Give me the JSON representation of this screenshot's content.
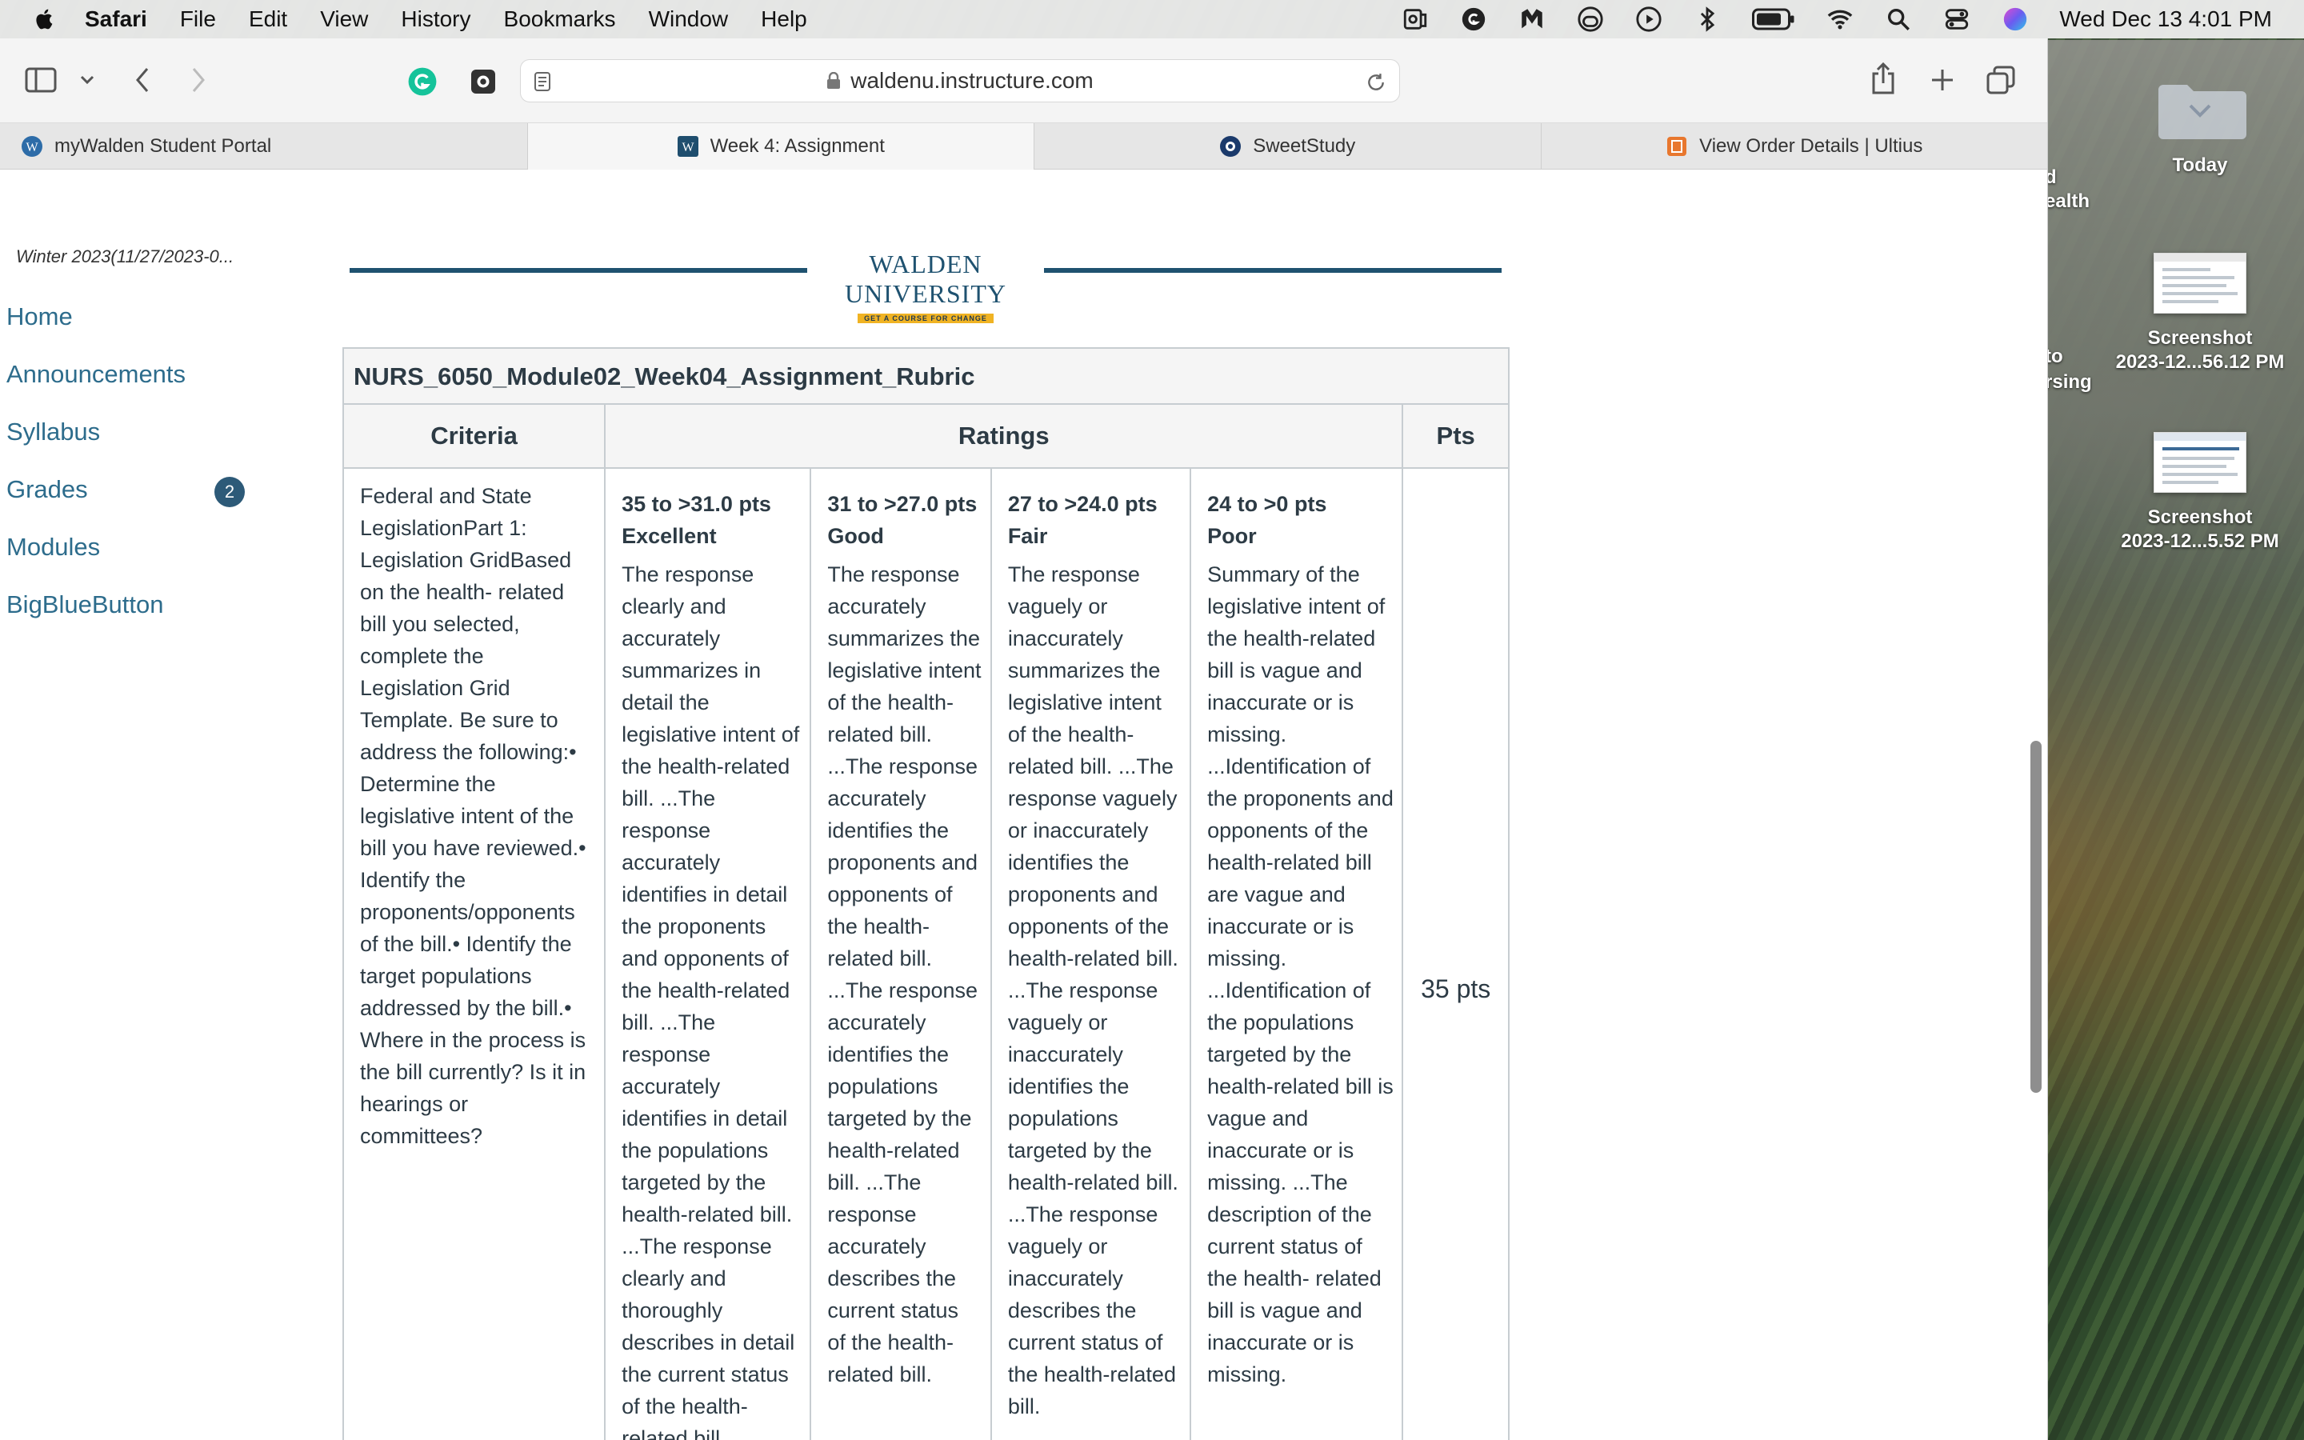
{
  "menubar": {
    "app_name": "Safari",
    "items": [
      "File",
      "Edit",
      "View",
      "History",
      "Bookmarks",
      "Window",
      "Help"
    ],
    "clock": "Wed Dec 13  4:01 PM"
  },
  "toolbar": {
    "url": "waldenu.instructure.com"
  },
  "tabs": [
    {
      "label": "myWalden Student Portal",
      "favicon_color": "#2d6ca8"
    },
    {
      "label": "Week 4: Assignment",
      "favicon_color": "#1f4e6e"
    },
    {
      "label": "SweetStudy",
      "favicon_color": "#1b3a6b"
    },
    {
      "label": "View Order Details | Ultius",
      "favicon_color": "#e8772e"
    }
  ],
  "sidebar": {
    "term": "Winter 2023(11/27/2023-0...",
    "items": [
      {
        "label": "Home"
      },
      {
        "label": "Announcements"
      },
      {
        "label": "Syllabus"
      },
      {
        "label": "Grades",
        "badge": "2"
      },
      {
        "label": "Modules"
      },
      {
        "label": "BigBlueButton"
      }
    ]
  },
  "banner": {
    "name": "WALDEN UNIVERSITY",
    "tagline": "GET A COURSE FOR CHANGE"
  },
  "rubric": {
    "title": "NURS_6050_Module02_Week04_Assignment_Rubric",
    "headers": {
      "criteria": "Criteria",
      "ratings": "Ratings",
      "pts": "Pts"
    },
    "criteria_text": "Federal and State LegislationPart 1: Legislation GridBased on the health- related bill you selected, complete the Legislation Grid Template. Be sure to address the following:• Determine the legislative intent of the bill you have reviewed.• Identify the proponents/opponents of the bill.• Identify the target populations addressed by the bill.• Where in the process is the bill currently? Is it in hearings or committees?",
    "ratings": [
      {
        "pts": "35 to >31.0 pts",
        "label": "Excellent",
        "description": "The response clearly and accurately summarizes in detail the legislative intent of the health-related bill. ...The response accurately identifies in detail the proponents and opponents of the health-related bill. ...The response accurately identifies in detail the populations targeted by the health-related bill. ...The response clearly and thoroughly describes in detail the current status of the health-related bill."
      },
      {
        "pts": "31 to >27.0 pts",
        "label": "Good",
        "description": "The response accurately summarizes the legislative intent of the health-related bill. ...The response accurately identifies the proponents and opponents of the health-related bill. ...The response accurately identifies the populations targeted by the health-related bill. ...The response accurately describes the current status of the health-related bill."
      },
      {
        "pts": "27 to >24.0 pts",
        "label": "Fair",
        "description": "The response vaguely or inaccurately summarizes the legislative intent of the health-related bill. ...The response vaguely or inaccurately identifies the proponents and opponents of the health-related bill. ...The response vaguely or inaccurately identifies the populations targeted by the health-related bill. ...The response vaguely or inaccurately describes the current status of the health-related bill."
      },
      {
        "pts": "24 to >0 pts",
        "label": "Poor",
        "description": "Summary of the legislative intent of the health-related bill is vague and inaccurate or is missing. ...Identification of the proponents and opponents of the health-related bill are vague and inaccurate or is missing. ...Identification of the populations targeted by the health-related bill is vague and inaccurate or is missing. ...The description of the current status of the health- related bill is vague and inaccurate or is missing."
      }
    ],
    "points": "35 pts"
  },
  "desktop": {
    "today": "Today",
    "screenshot1": {
      "line1": "Screenshot",
      "line2": "2023-12...56.12 PM"
    },
    "screenshot2": {
      "line1": "Screenshot",
      "line2": "2023-12...5.52 PM"
    },
    "edge_labels": [
      "d",
      "ealth",
      "to",
      "rsing"
    ]
  }
}
